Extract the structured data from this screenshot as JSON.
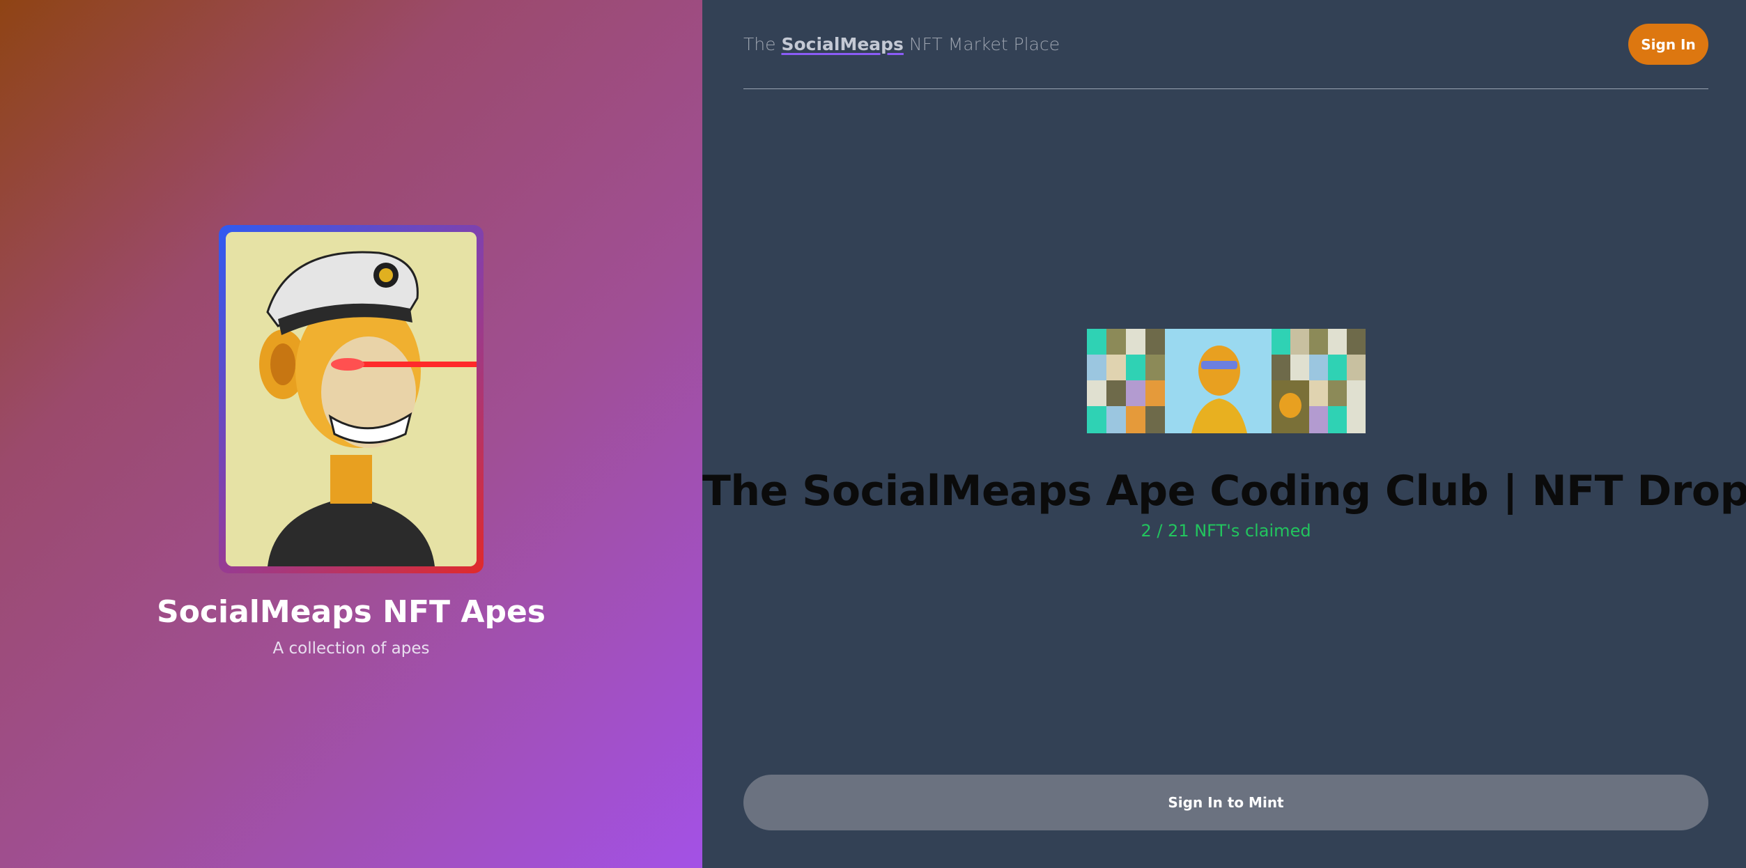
{
  "collection": {
    "title": "SocialMeaps NFT Apes",
    "subtitle": "A collection of apes"
  },
  "header": {
    "brand_prefix": "The",
    "brand_name": "SocialMeaps",
    "brand_suffix": "NFT Market Place",
    "signin_label": "Sign In"
  },
  "drop": {
    "title": "The SocialMeaps Ape Coding Club | NFT Drop",
    "claimed_text": "2 / 21 NFT's claimed",
    "claimed": 2,
    "total": 21
  },
  "mint": {
    "button_label": "Sign In to Mint"
  },
  "colors": {
    "panel": "#334155",
    "accent_button": "#dd7710",
    "claimed_text": "#22c55e",
    "mint_button": "#6b7280"
  }
}
